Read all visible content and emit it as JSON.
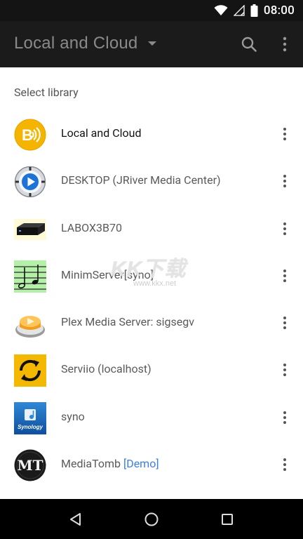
{
  "status_bar": {
    "time": "08:00"
  },
  "app_bar": {
    "title": "Local and Cloud"
  },
  "content": {
    "subheader": "Select library",
    "libraries": [
      {
        "name": "Local and Cloud",
        "icon": "local-and-cloud-icon",
        "selected": true
      },
      {
        "name": "DESKTOP (JRiver Media Center)",
        "icon": "jriver-icon"
      },
      {
        "name": "LABOX3B70",
        "icon": "labox-device-icon"
      },
      {
        "name": "MinimServer[syno]",
        "icon": "minimserver-icon"
      },
      {
        "name": "Plex Media Server: sigsegv",
        "icon": "plex-icon"
      },
      {
        "name": "Serviio (localhost)",
        "icon": "serviio-icon"
      },
      {
        "name": "syno",
        "icon": "synology-icon"
      },
      {
        "name": "MediaTomb",
        "tag": "[Demo]",
        "icon": "mediatomb-icon"
      }
    ]
  },
  "watermark": {
    "text": "KK下载",
    "subtext": "www.kkx.net"
  },
  "colors": {
    "app_bar": "#1b1b1b",
    "status_bar": "#141414",
    "accent_link": "#3d7fd9"
  }
}
